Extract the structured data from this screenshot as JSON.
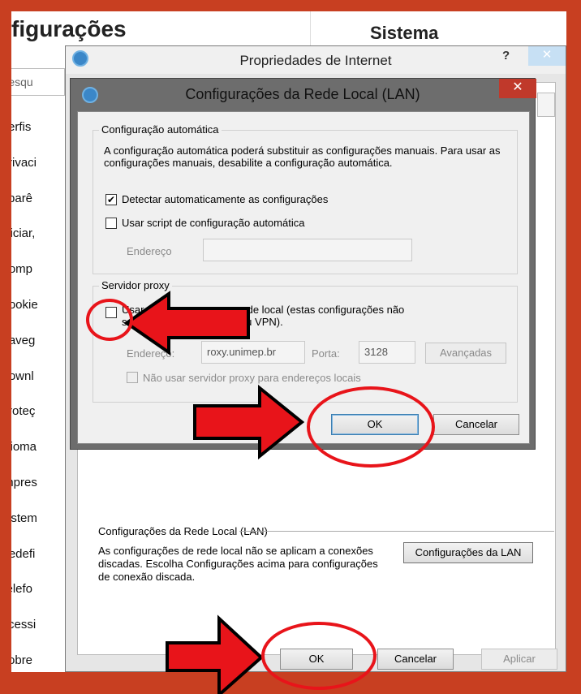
{
  "settings": {
    "title": "figurações",
    "search_placeholder": "Pesqu",
    "nav_items": [
      "Perfis",
      "Privaci",
      "Aparê",
      "Iniciar,",
      "Comp",
      "Cookie",
      "Naveg",
      "Downl",
      "Proteç",
      "Idioma",
      "Impres",
      "Sistem",
      "Redefi",
      "Telefo",
      "Acessi",
      "Sobre"
    ],
    "right_title": "Sistema"
  },
  "inet_dialog": {
    "title": "Propriedades de Internet",
    "help": "?",
    "close": "✕",
    "lan_group_title": "Configurações da Rede Local (LAN)",
    "lan_group_text": "As configurações de rede local não se aplicam a conexões discadas. Escolha Configurações acima para configurações de conexão discada.",
    "lan_button": "Configurações da LAN",
    "ok": "OK",
    "cancel": "Cancelar",
    "apply": "Aplicar"
  },
  "lan_dialog": {
    "title": "Configurações da Rede Local (LAN)",
    "close": "✕",
    "auto_group": {
      "title": "Configuração automática",
      "description": "A configuração automática poderá substituir as configurações manuais. Para usar as configurações manuais, desabilite a configuração automática.",
      "detect_label": "Detectar automaticamente as configurações",
      "detect_checked": true,
      "script_label": "Usar script de configuração automática",
      "script_checked": false,
      "address_label": "Endereço",
      "address_value": ""
    },
    "proxy_group": {
      "title": "Servidor proxy",
      "use_proxy_line1": "Usar um            y para a rede local (estas configurações não",
      "use_proxy_line2": "se aplic             discadas ou VPN).",
      "use_proxy_checked": false,
      "address_label": "Endereço:",
      "address_value": "roxy.unimep.br",
      "port_label": "Porta:",
      "port_value": "3128",
      "advanced_button": "Avançadas",
      "bypass_label": "Não usar servidor proxy para endereços locais",
      "bypass_checked": false
    },
    "ok": "OK",
    "cancel": "Cancelar"
  },
  "colors": {
    "frame": "#c83f21",
    "annotation": "#e8141a",
    "lan_close": "#c0392b"
  }
}
